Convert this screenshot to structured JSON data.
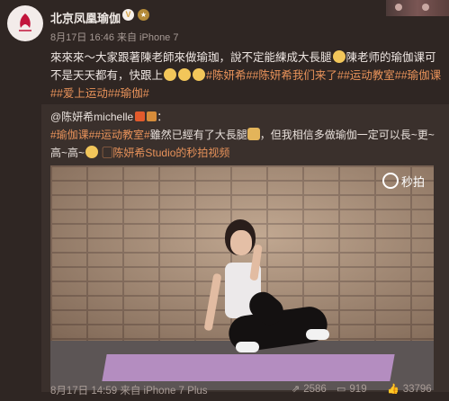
{
  "author": {
    "name": "北京凤凰瑜伽",
    "vip_badge": "V",
    "meta": "8月17日 16:46 来自 iPhone 7"
  },
  "post": {
    "text_1": "來來來～大家跟著陳老師來做瑜珈，說不定能練成大長腿",
    "text_2": "陳老师的瑜伽课可不是天天都有，快跟上",
    "tags": [
      "#陈妍希#",
      "#陈妍希我们来了#",
      "#运动教室#",
      "#瑜伽课#",
      "#爱上运动#",
      "#瑜伽#"
    ]
  },
  "repost": {
    "handle": "@陈妍希michelle",
    "tags": [
      "#瑜伽课#",
      "#运动教室#"
    ],
    "text": "雖然已經有了大長腿",
    "text_2": "，但我相信多做瑜伽一定可以長~更~高~高~",
    "video_link": "陈妍希Studio的秒拍视频",
    "watermark": "秒拍",
    "meta": "8月17日 14:59 来自 iPhone 7 Plus",
    "shares": "2586",
    "comments": "919",
    "likes": "33796"
  },
  "icons": {
    "avatar_logo": "phoenix-logo-icon",
    "share": "share-icon",
    "comment": "comment-icon",
    "like": "thumbs-up-icon",
    "video": "video-link-icon"
  },
  "colors": {
    "background": "#2f2623",
    "repost_background": "#3a302c",
    "tag": "#e8925a"
  }
}
